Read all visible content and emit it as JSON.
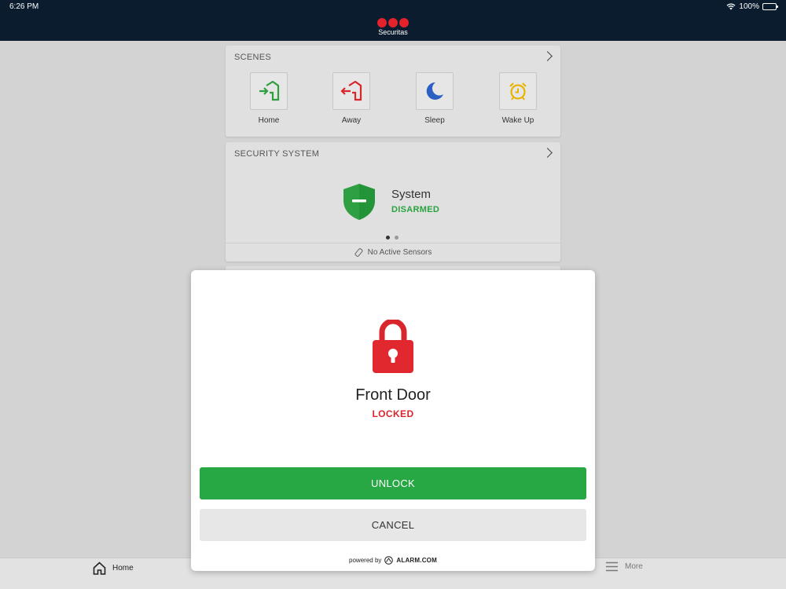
{
  "status": {
    "time": "6:26 PM",
    "battery": "100%"
  },
  "header": {
    "brand": "Securitas"
  },
  "scenes": {
    "title": "SCENES",
    "items": [
      {
        "label": "Home",
        "icon": "home-arrive-icon",
        "color": "#2e9e3f"
      },
      {
        "label": "Away",
        "icon": "home-leave-icon",
        "color": "#d9262c"
      },
      {
        "label": "Sleep",
        "icon": "moon-icon",
        "color": "#2c5fc4"
      },
      {
        "label": "Wake Up",
        "icon": "alarm-clock-icon",
        "color": "#e8b400"
      }
    ]
  },
  "security": {
    "title": "SECURITY SYSTEM",
    "system_name": "System",
    "state": "DISARMED",
    "state_color": "#29a33f",
    "sensors": "No Active Sensors"
  },
  "tabs": {
    "home": "Home",
    "more": "More"
  },
  "modal": {
    "device_name": "Front Door",
    "state": "LOCKED",
    "state_color": "#d9262c",
    "unlock_label": "UNLOCK",
    "cancel_label": "CANCEL",
    "powered_by": "powered by",
    "powered_brand": "ALARM.COM"
  }
}
